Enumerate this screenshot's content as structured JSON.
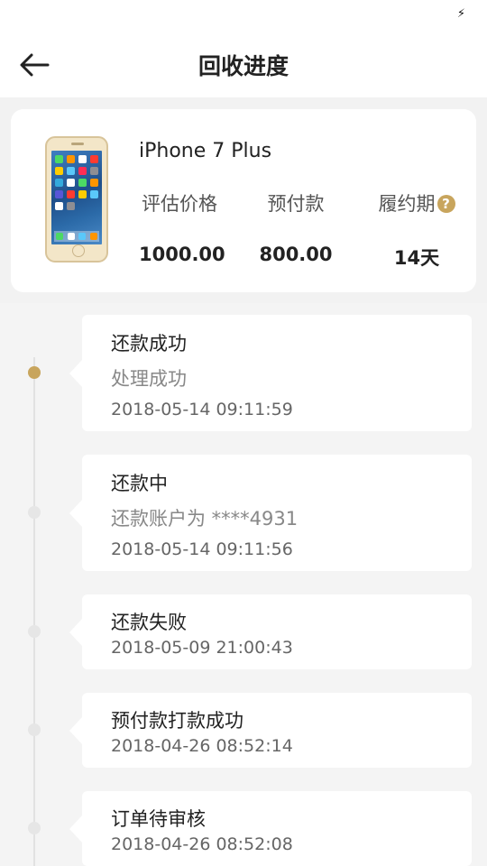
{
  "header": {
    "title": "回收进度"
  },
  "product": {
    "model": "iPhone 7 Plus",
    "labels": {
      "price": "评估价格",
      "prepay": "预付款",
      "term": "履约期"
    },
    "values": {
      "price": "1000.00",
      "prepay": "800.00",
      "term": "14天"
    },
    "help_icon": "?"
  },
  "timeline": [
    {
      "title": "还款成功",
      "detail": "处理成功",
      "time": "2018-05-14 09:11:59",
      "active": true
    },
    {
      "title": "还款中",
      "detail": "还款账户为 ****4931",
      "time": "2018-05-14 09:11:56",
      "active": false
    },
    {
      "title": "还款失败",
      "detail": "",
      "time": "2018-05-09 21:00:43",
      "active": false
    },
    {
      "title": "预付款打款成功",
      "detail": "",
      "time": "2018-04-26 08:52:14",
      "active": false
    },
    {
      "title": "订单待审核",
      "detail": "",
      "time": "2018-04-26 08:52:08",
      "active": false
    }
  ],
  "colors": {
    "accent": "#c8a55d",
    "background": "#f4f4f4"
  }
}
